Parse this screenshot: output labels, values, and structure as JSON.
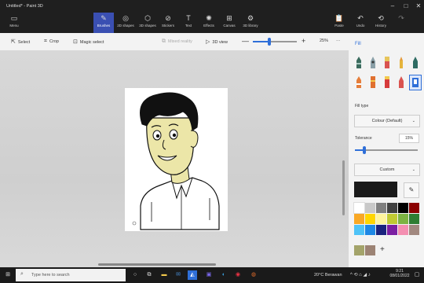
{
  "window": {
    "title": "Untitled* - Paint 3D",
    "controls": [
      "–",
      "□",
      "✕"
    ]
  },
  "ribbon": {
    "menu_label": "Menu",
    "tools": [
      {
        "label": "Brushes",
        "icon": "brush-icon"
      },
      {
        "label": "2D shapes",
        "icon": "2d-shapes-icon"
      },
      {
        "label": "3D shapes",
        "icon": "3d-shapes-icon"
      },
      {
        "label": "Stickers",
        "icon": "stickers-icon"
      },
      {
        "label": "Text",
        "icon": "text-icon"
      },
      {
        "label": "Effects",
        "icon": "effects-icon"
      },
      {
        "label": "Canvas",
        "icon": "canvas-icon"
      },
      {
        "label": "3D library",
        "icon": "3d-library-icon"
      }
    ],
    "active_tool": "Brushes",
    "right_actions": [
      {
        "label": "Paste",
        "icon": "paste-icon"
      },
      {
        "label": "Undo",
        "icon": "undo-icon"
      },
      {
        "label": "History",
        "icon": "history-icon"
      },
      {
        "label": "",
        "icon": "redo-icon"
      }
    ]
  },
  "toolbar": {
    "select_label": "Select",
    "crop_label": "Crop",
    "magic_select_label": "Magic select",
    "mixed_reality_label": "Mixed reality",
    "view_3d_label": "3D view",
    "zoom_minus": "—",
    "zoom_plus": "+",
    "zoom_value": 25,
    "zoom_label": "25%",
    "more": "···"
  },
  "side_panel": {
    "heading": "Fill",
    "brushes": [
      "marker",
      "calligraphy-pen",
      "oil-brush",
      "watercolor",
      "pencil",
      "eraser",
      "crayon",
      "pixel-pen",
      "spraycan",
      "fill"
    ],
    "selected_brush": "fill",
    "fill_type_label": "Fill type",
    "fill_type_value": "Colour (Default)",
    "tolerance_label": "Tolerance",
    "tolerance_value": "15%",
    "custom_label": "Custom",
    "current_color": "#1a1a1a",
    "palette": [
      "#ffffff",
      "#c8c8c8",
      "#7f7f7f",
      "#404040",
      "#000000",
      "#8b0000",
      "#f9a825",
      "#ffd600",
      "#fff59d",
      "#c0ca33",
      "#7cb342",
      "#2e7d32",
      "#4fc3f7",
      "#1e88e5",
      "#1a237e",
      "#7b1fa2",
      "#f48fb1",
      "#a1887f"
    ],
    "custom_swatches": [
      "#a4a46b",
      "#9c8374"
    ],
    "add_label": "+"
  },
  "taskbar": {
    "search_placeholder": "Type here to search",
    "weather": "20°C  Berawan",
    "time": "9:21",
    "date": "08/01/2022",
    "icons": [
      "windows-icon",
      "search-icon",
      "task-view-icon",
      "file-explorer-icon",
      "mail-icon",
      "store-icon",
      "paint3d-icon",
      "edge-icon",
      "chrome-icon",
      "word-icon",
      "firefox-icon"
    ]
  }
}
